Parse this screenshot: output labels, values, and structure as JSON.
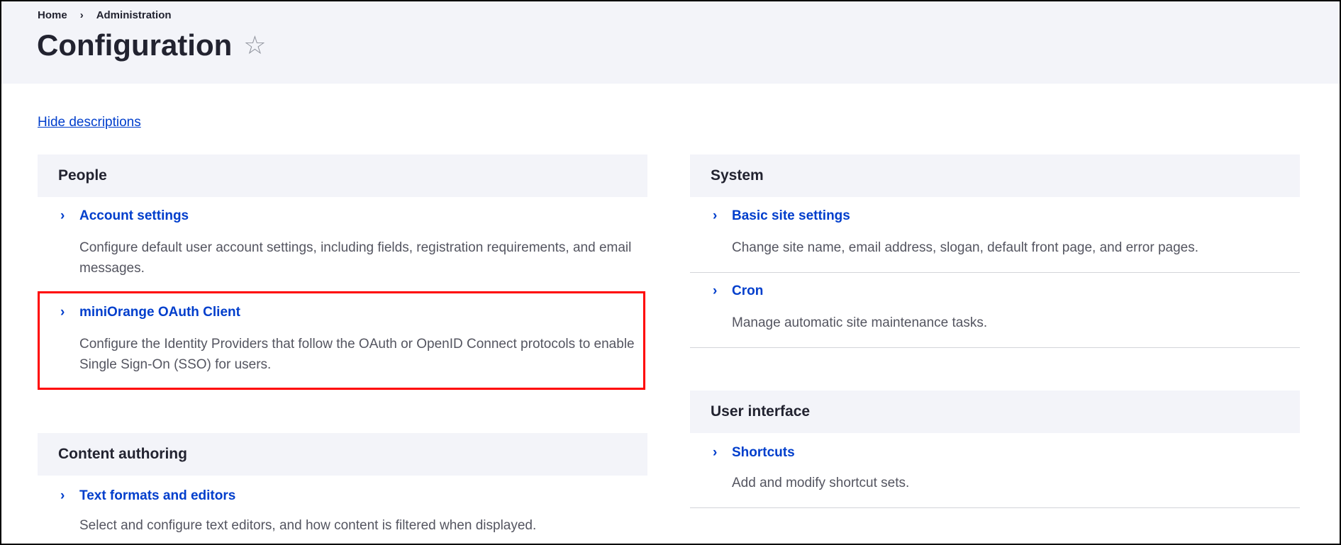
{
  "breadcrumb": [
    "Home",
    "Administration"
  ],
  "title": "Configuration",
  "hide_descriptions": "Hide descriptions",
  "left": {
    "people": {
      "title": "People",
      "items": [
        {
          "label": "Account settings",
          "desc": "Configure default user account settings, including fields, registration requirements, and email messages."
        },
        {
          "label": "miniOrange OAuth Client",
          "desc": "Configure the Identity Providers that follow the OAuth or OpenID Connect protocols to enable Single Sign-On (SSO) for users."
        }
      ]
    },
    "content": {
      "title": "Content authoring",
      "items": [
        {
          "label": "Text formats and editors",
          "desc": "Select and configure text editors, and how content is filtered when displayed."
        }
      ]
    }
  },
  "right": {
    "system": {
      "title": "System",
      "items": [
        {
          "label": "Basic site settings",
          "desc": "Change site name, email address, slogan, default front page, and error pages."
        },
        {
          "label": "Cron",
          "desc": "Manage automatic site maintenance tasks."
        }
      ]
    },
    "ui": {
      "title": "User interface",
      "items": [
        {
          "label": "Shortcuts",
          "desc": "Add and modify shortcut sets."
        }
      ]
    }
  },
  "colors": {
    "link": "#003ecc",
    "highlight": "#ff0000",
    "header_bg": "#f3f4f9"
  }
}
